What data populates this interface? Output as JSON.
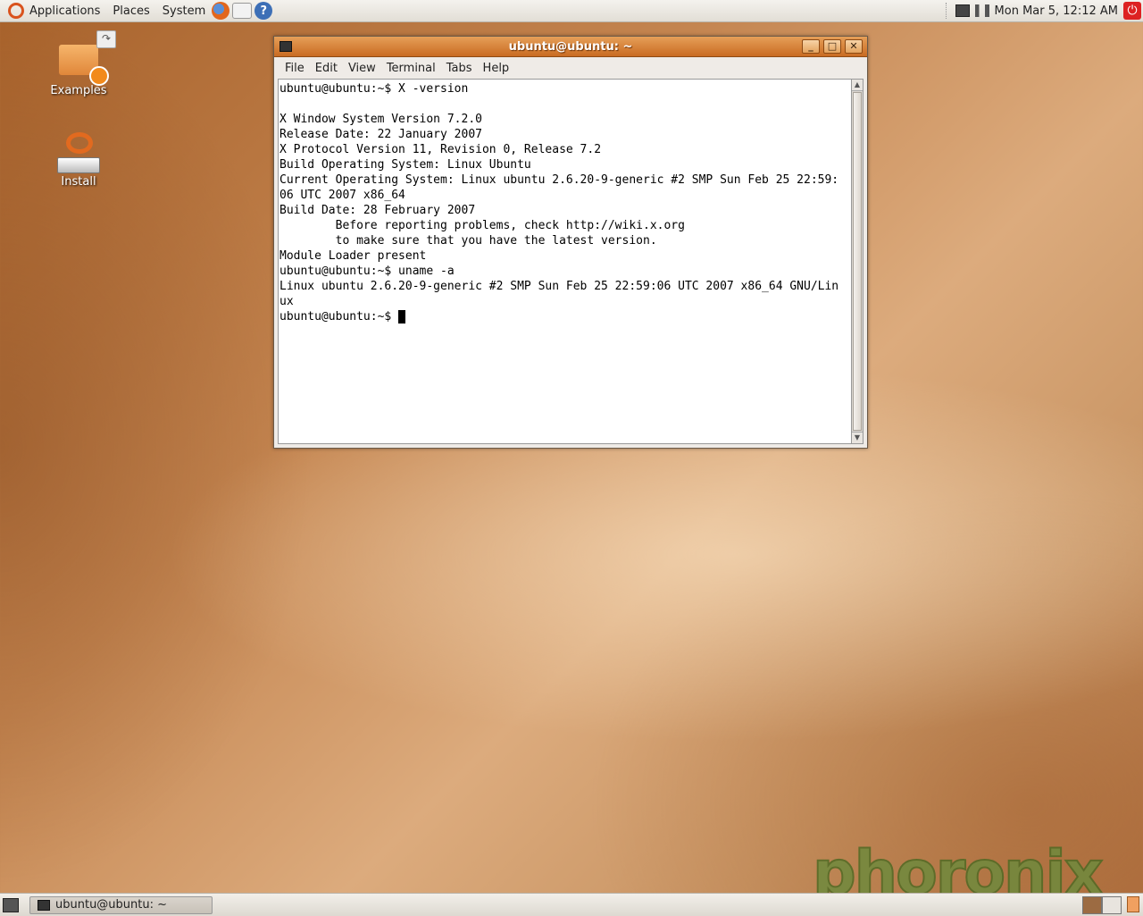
{
  "top_panel": {
    "menus": [
      "Applications",
      "Places",
      "System"
    ],
    "launchers": [
      "firefox-icon",
      "mail-icon",
      "help-icon"
    ],
    "help_glyph": "?",
    "clock": "Mon Mar  5, 12:12 AM",
    "power_glyph": "⏻"
  },
  "desktop": {
    "icons": [
      {
        "label": "Examples",
        "icon": "folder-icon"
      },
      {
        "label": "Install",
        "icon": "install-icon"
      }
    ]
  },
  "terminal_window": {
    "title": "ubuntu@ubuntu: ~",
    "controls": {
      "minimize": "_",
      "maximize": "□",
      "close": "✕"
    },
    "menu": [
      "File",
      "Edit",
      "View",
      "Terminal",
      "Tabs",
      "Help"
    ],
    "lines": [
      "ubuntu@ubuntu:~$ X -version",
      "",
      "X Window System Version 7.2.0",
      "Release Date: 22 January 2007",
      "X Protocol Version 11, Revision 0, Release 7.2",
      "Build Operating System: Linux Ubuntu",
      "Current Operating System: Linux ubuntu 2.6.20-9-generic #2 SMP Sun Feb 25 22:59:",
      "06 UTC 2007 x86_64",
      "Build Date: 28 February 2007",
      "        Before reporting problems, check http://wiki.x.org",
      "        to make sure that you have the latest version.",
      "Module Loader present",
      "ubuntu@ubuntu:~$ uname -a",
      "Linux ubuntu 2.6.20-9-generic #2 SMP Sun Feb 25 22:59:06 UTC 2007 x86_64 GNU/Lin",
      "ux"
    ],
    "prompt": "ubuntu@ubuntu:~$ "
  },
  "bottom_panel": {
    "tasks": [
      {
        "label": "ubuntu@ubuntu: ~"
      }
    ]
  },
  "watermark": "phoronix"
}
